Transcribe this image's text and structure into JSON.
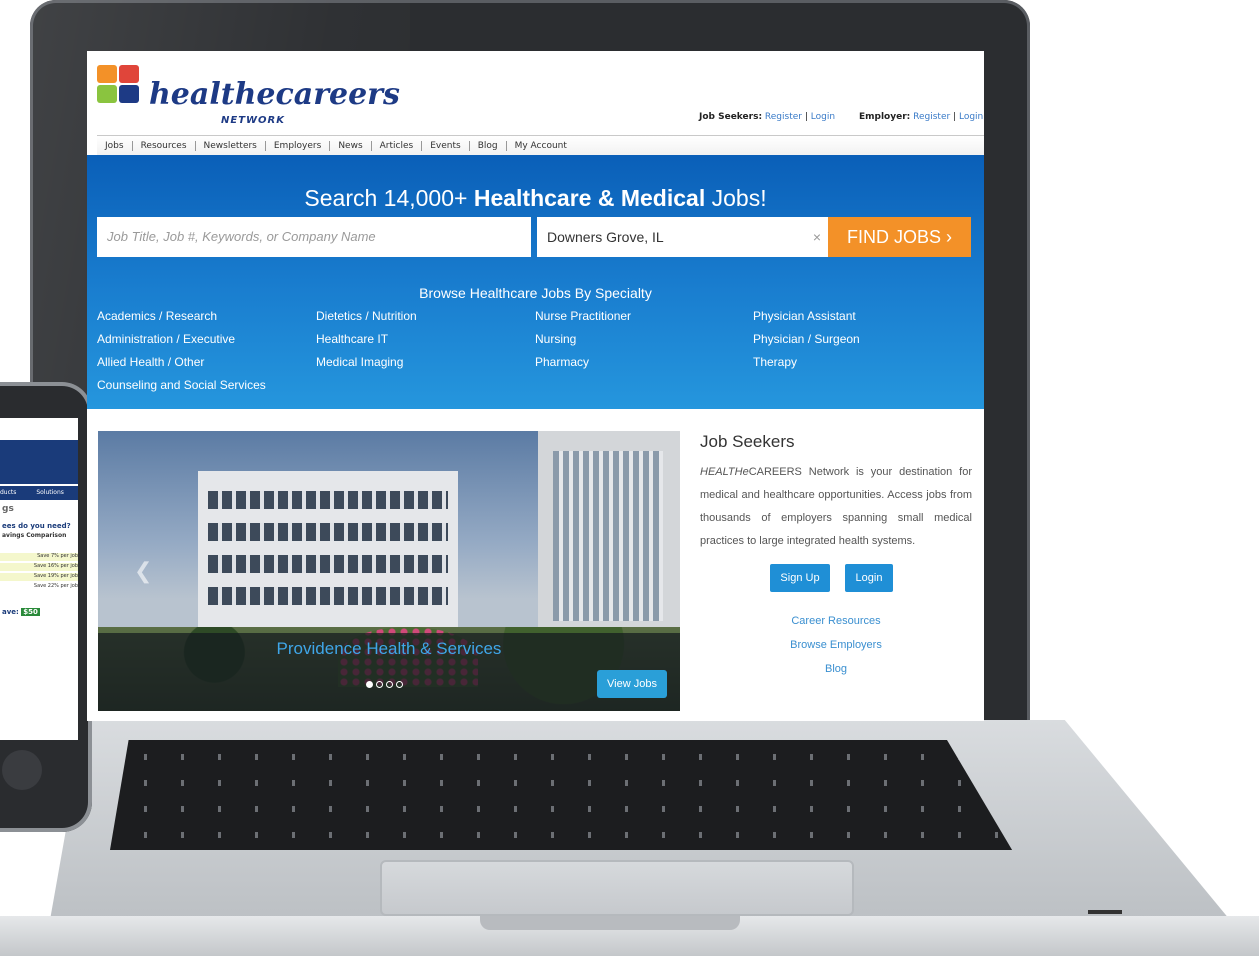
{
  "site": {
    "logo_text": "healthecareers",
    "logo_sub": "NETWORK"
  },
  "account_links": {
    "job_seekers_label": "Job Seekers:",
    "employer_label": "Employer:",
    "register": "Register",
    "login": "Login",
    "separator": "|"
  },
  "nav": {
    "items": [
      "Jobs",
      "Resources",
      "Newsletters",
      "Employers",
      "News",
      "Articles",
      "Events",
      "Blog",
      "My Account"
    ]
  },
  "hero": {
    "title_prefix": "Search 14,000+",
    "title_emphasis": "Healthcare & Medical",
    "title_suffix": "Jobs!",
    "keyword_placeholder": "Job Title, Job #, Keywords, or Company Name",
    "location_value": "Downers Grove, IL",
    "clear_glyph": "×",
    "find_button": "FIND JOBS ›",
    "browse_title": "Browse Healthcare Jobs By Specialty",
    "specialties": [
      [
        "Academics / Research",
        "Administration / Executive",
        "Allied Health / Other",
        "Counseling and Social Services"
      ],
      [
        "Dietetics / Nutrition",
        "Healthcare IT",
        "Medical Imaging"
      ],
      [
        "Nurse Practitioner",
        "Nursing",
        "Pharmacy"
      ],
      [
        "Physician Assistant",
        "Physician / Surgeon",
        "Therapy"
      ]
    ]
  },
  "slider": {
    "caption": "Providence Health & Services",
    "view_button": "View Jobs",
    "prev_glyph": "❮",
    "active_slide": 1,
    "slide_count": 4
  },
  "job_seekers": {
    "title": "Job Seekers",
    "brand_italic": "HEALTHe",
    "brand_rest": "CAREERS",
    "description": " Network is your destination for medical and healthcare opportunities. Access jobs from thousands of employers spanning small medical practices to large integrated health systems.",
    "sign_up": "Sign Up",
    "login": "Login",
    "links": [
      "Career Resources",
      "Browse Employers",
      "Blog"
    ]
  },
  "phone": {
    "nav_a": "ducts",
    "nav_b": "Solutions",
    "heading": "gs",
    "question": "ees do you need?",
    "subhead": "avings Comparison",
    "rows": [
      "Save 7% per job",
      "Save 16% per job",
      "Save 19% per job",
      "Save 22% per job"
    ],
    "save_label": "ave:",
    "save_value": "$50"
  },
  "colors": {
    "brand_blue": "#1d3a85",
    "hero_blue": "#0a5fb8",
    "find_orange": "#f39128",
    "link_blue": "#3a8fd0",
    "button_blue": "#1f8fd6"
  }
}
